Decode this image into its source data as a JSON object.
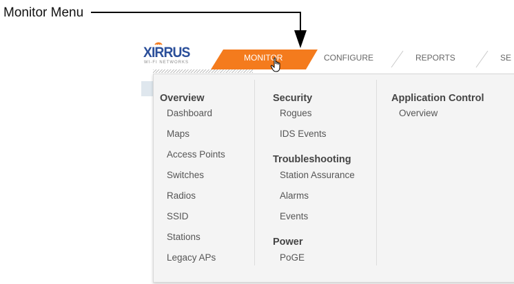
{
  "callout": {
    "label": "Monitor Menu"
  },
  "logo": {
    "wordmark": "XIRRUS",
    "tagline": "WI-FI NETWORKS"
  },
  "nav": {
    "tabs": [
      {
        "label": "MONITOR",
        "active": true
      },
      {
        "label": "CONFIGURE",
        "active": false
      },
      {
        "label": "REPORTS",
        "active": false
      },
      {
        "label": "SE",
        "active": false
      }
    ],
    "active_color": "#f47b1d"
  },
  "menu": {
    "columns": [
      {
        "sections": [
          {
            "heading": "Overview",
            "items": [
              "Dashboard",
              "Maps",
              "Access Points",
              "Switches",
              "Radios",
              "SSID",
              "Stations",
              "Legacy APs"
            ]
          }
        ]
      },
      {
        "sections": [
          {
            "heading": "Security",
            "items": [
              "Rogues",
              "IDS Events"
            ]
          },
          {
            "heading": "Troubleshooting",
            "items": [
              "Station Assurance",
              "Alarms",
              "Events"
            ]
          },
          {
            "heading": "Power",
            "items": [
              "PoGE"
            ]
          }
        ]
      },
      {
        "sections": [
          {
            "heading": "Application Control",
            "items": [
              "Overview"
            ]
          }
        ]
      }
    ]
  }
}
